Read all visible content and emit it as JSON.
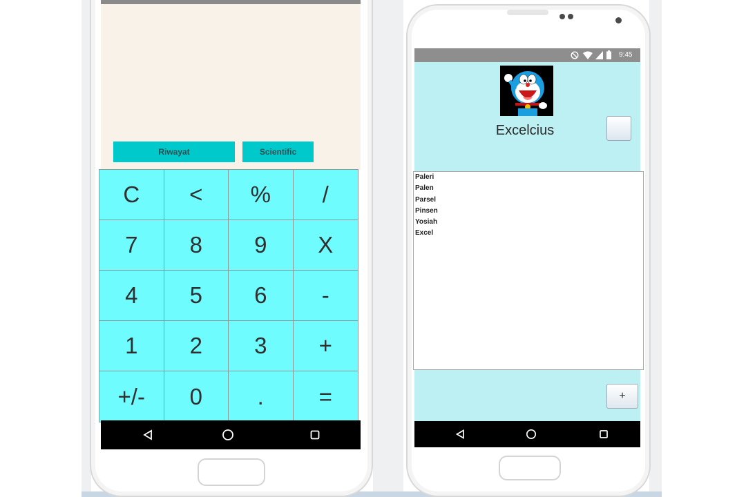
{
  "calculator": {
    "history_label": "Riwayat",
    "scientific_label": "Scientific",
    "keys": [
      "C",
      "<",
      "%",
      "/",
      "7",
      "8",
      "9",
      "X",
      "4",
      "5",
      "6",
      "-",
      "1",
      "2",
      "3",
      "+",
      "+/-",
      "0",
      ".",
      "="
    ]
  },
  "contacts_app": {
    "status_time": "9:45",
    "title": "Excelcius",
    "list_items": [
      "Paleri",
      "Palen",
      "Parsel",
      "Pinsen",
      "Yosiah",
      "Excel"
    ],
    "add_label": "+"
  },
  "icons": {
    "nav_back": "back-triangle-icon",
    "nav_home": "home-circle-icon",
    "nav_recents": "recents-square-icon"
  },
  "colors": {
    "keypad": "#6ffcff",
    "action_button": "#00c9cc",
    "header_bg": "#bdf0f2",
    "display_bg": "#f8f2e8"
  }
}
